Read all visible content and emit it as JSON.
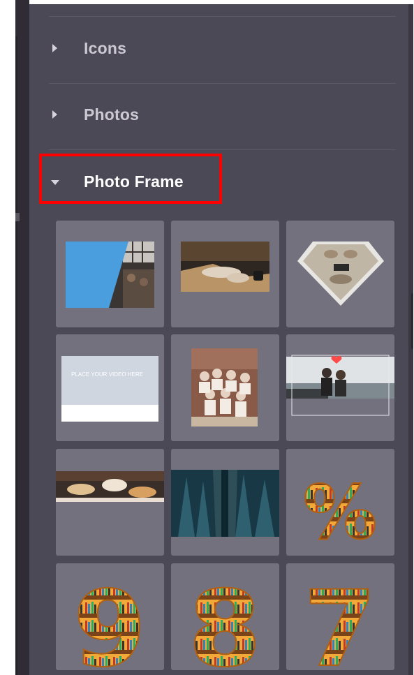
{
  "panel": {
    "sections": [
      {
        "label": "Icons",
        "expanded": false
      },
      {
        "label": "Photos",
        "expanded": false
      },
      {
        "label": "Photo Frame",
        "expanded": true,
        "highlighted": true
      }
    ]
  },
  "photo_frame": {
    "tiles": [
      {
        "name": "diagonal-split-frame"
      },
      {
        "name": "wide-banner-frame"
      },
      {
        "name": "diamond-frame"
      },
      {
        "name": "placeholder-text-frame",
        "placeholder_text": "PLACE YOUR VIDEO HERE"
      },
      {
        "name": "portrait-group-frame"
      },
      {
        "name": "heart-landscape-frame"
      },
      {
        "name": "thin-banner-frame"
      },
      {
        "name": "forest-frame"
      },
      {
        "name": "percent-sign-frame",
        "glyph": "%"
      },
      {
        "name": "digit-nine-frame",
        "glyph": "9"
      },
      {
        "name": "digit-eight-frame",
        "glyph": "8"
      },
      {
        "name": "digit-seven-frame",
        "glyph": "7"
      }
    ]
  },
  "colors": {
    "panel_bg": "#4c4956",
    "tile_bg": "#74717e",
    "highlight": "#ff0000",
    "label_active": "#ffffff",
    "label_inactive": "#ccc9d3"
  }
}
